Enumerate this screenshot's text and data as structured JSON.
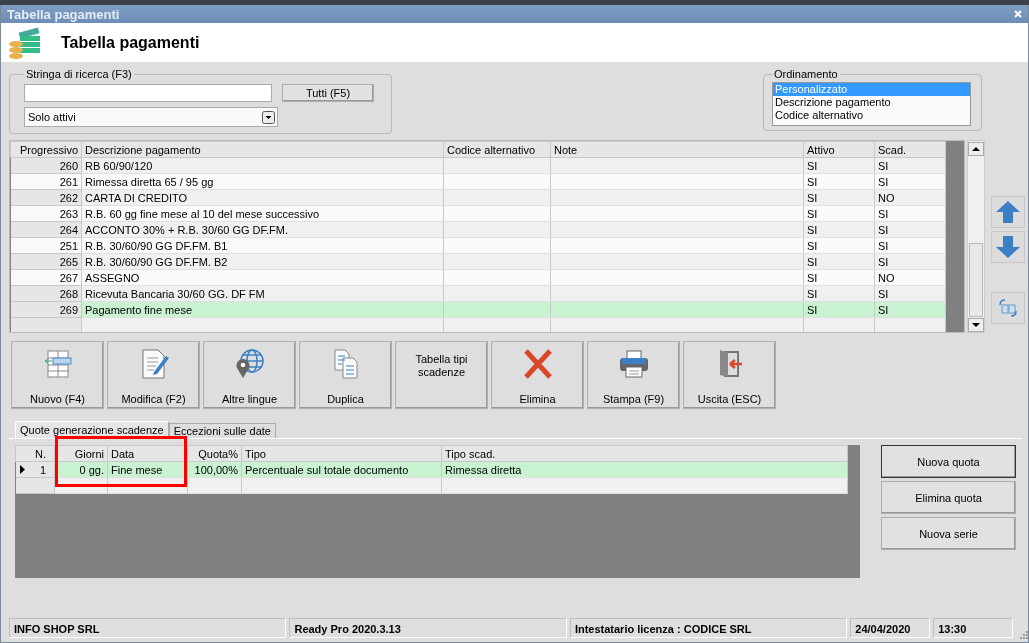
{
  "window": {
    "title": "Tabella pagamenti"
  },
  "header": {
    "title": "Tabella pagamenti"
  },
  "search": {
    "label": "Stringa di ricerca (F3)",
    "button": "Tutti (F5)",
    "filter": "Solo attivi"
  },
  "ordering": {
    "label": "Ordinamento",
    "options": [
      {
        "label": "Personalizzato",
        "selected": true
      },
      {
        "label": "Descrizione pagamento",
        "selected": false
      },
      {
        "label": "Codice alternativo",
        "selected": false
      }
    ]
  },
  "table": {
    "columns": [
      "Progressivo",
      "Descrizione pagamento",
      "Codice alternativo",
      "Note",
      "Attivo",
      "Scad."
    ],
    "rows": [
      {
        "cells": [
          "260",
          "RB 60/90/120",
          "",
          "",
          "SI",
          "SI"
        ],
        "selected": false
      },
      {
        "cells": [
          "261",
          "Rimessa diretta 65 / 95 gg",
          "",
          "",
          "SI",
          "SI"
        ],
        "selected": false
      },
      {
        "cells": [
          "262",
          "CARTA DI CREDITO",
          "",
          "",
          "SI",
          "NO"
        ],
        "selected": false
      },
      {
        "cells": [
          "263",
          "R.B. 60 gg fine mese al 10 del mese successivo",
          "",
          "",
          "SI",
          "SI"
        ],
        "selected": false
      },
      {
        "cells": [
          "264",
          "ACCONTO 30% + R.B. 30/60 GG DF.FM.",
          "",
          "",
          "SI",
          "SI"
        ],
        "selected": false
      },
      {
        "cells": [
          "251",
          "R.B. 30/60/90 GG DF.FM. B1",
          "",
          "",
          "SI",
          "SI"
        ],
        "selected": false
      },
      {
        "cells": [
          "265",
          "R.B. 30/60/90 GG DF.FM. B2",
          "",
          "",
          "SI",
          "SI"
        ],
        "selected": false
      },
      {
        "cells": [
          "267",
          "ASSEGNO",
          "",
          "",
          "SI",
          "NO"
        ],
        "selected": false
      },
      {
        "cells": [
          "268",
          "Ricevuta Bancaria 30/60 GG. DF FM",
          "",
          "",
          "SI",
          "SI"
        ],
        "selected": false
      },
      {
        "cells": [
          "269",
          "Pagamento fine mese",
          "",
          "",
          "SI",
          "SI"
        ],
        "selected": true
      }
    ]
  },
  "toolbar": [
    {
      "label": "Nuovo (F4)",
      "kind": "icon"
    },
    {
      "label": "Modifica (F2)",
      "kind": "icon"
    },
    {
      "label": "Altre lingue",
      "kind": "icon"
    },
    {
      "label": "Duplica",
      "kind": "icon"
    },
    {
      "label": "Tabella tipi scadenze",
      "kind": "text"
    },
    {
      "label": "Elimina",
      "kind": "icon"
    },
    {
      "label": "Stampa (F9)",
      "kind": "icon"
    },
    {
      "label": "Uscita (ESC)",
      "kind": "icon"
    }
  ],
  "tabs": [
    {
      "label": "Quote generazione scadenze",
      "selected": true
    },
    {
      "label": "Eccezioni sulle date",
      "selected": false
    }
  ],
  "quote_table": {
    "columns": [
      "N.",
      "Giorni",
      "Data",
      "Quota%",
      "Tipo",
      "Tipo scad."
    ],
    "rows": [
      {
        "cells": [
          "1",
          "0 gg.",
          "Fine mese",
          "100,00%",
          "Percentuale sul totale documento",
          "Rimessa diretta"
        ],
        "selected": true
      }
    ]
  },
  "quote_buttons": [
    "Nuova quota",
    "Elimina quota",
    "Nuova serie"
  ],
  "status_bar": [
    "INFO SHOP SRL",
    "Ready Pro 2020.3.13",
    "Intestatario licenza : CODICE SRL",
    "24/04/2020",
    "13:30"
  ]
}
